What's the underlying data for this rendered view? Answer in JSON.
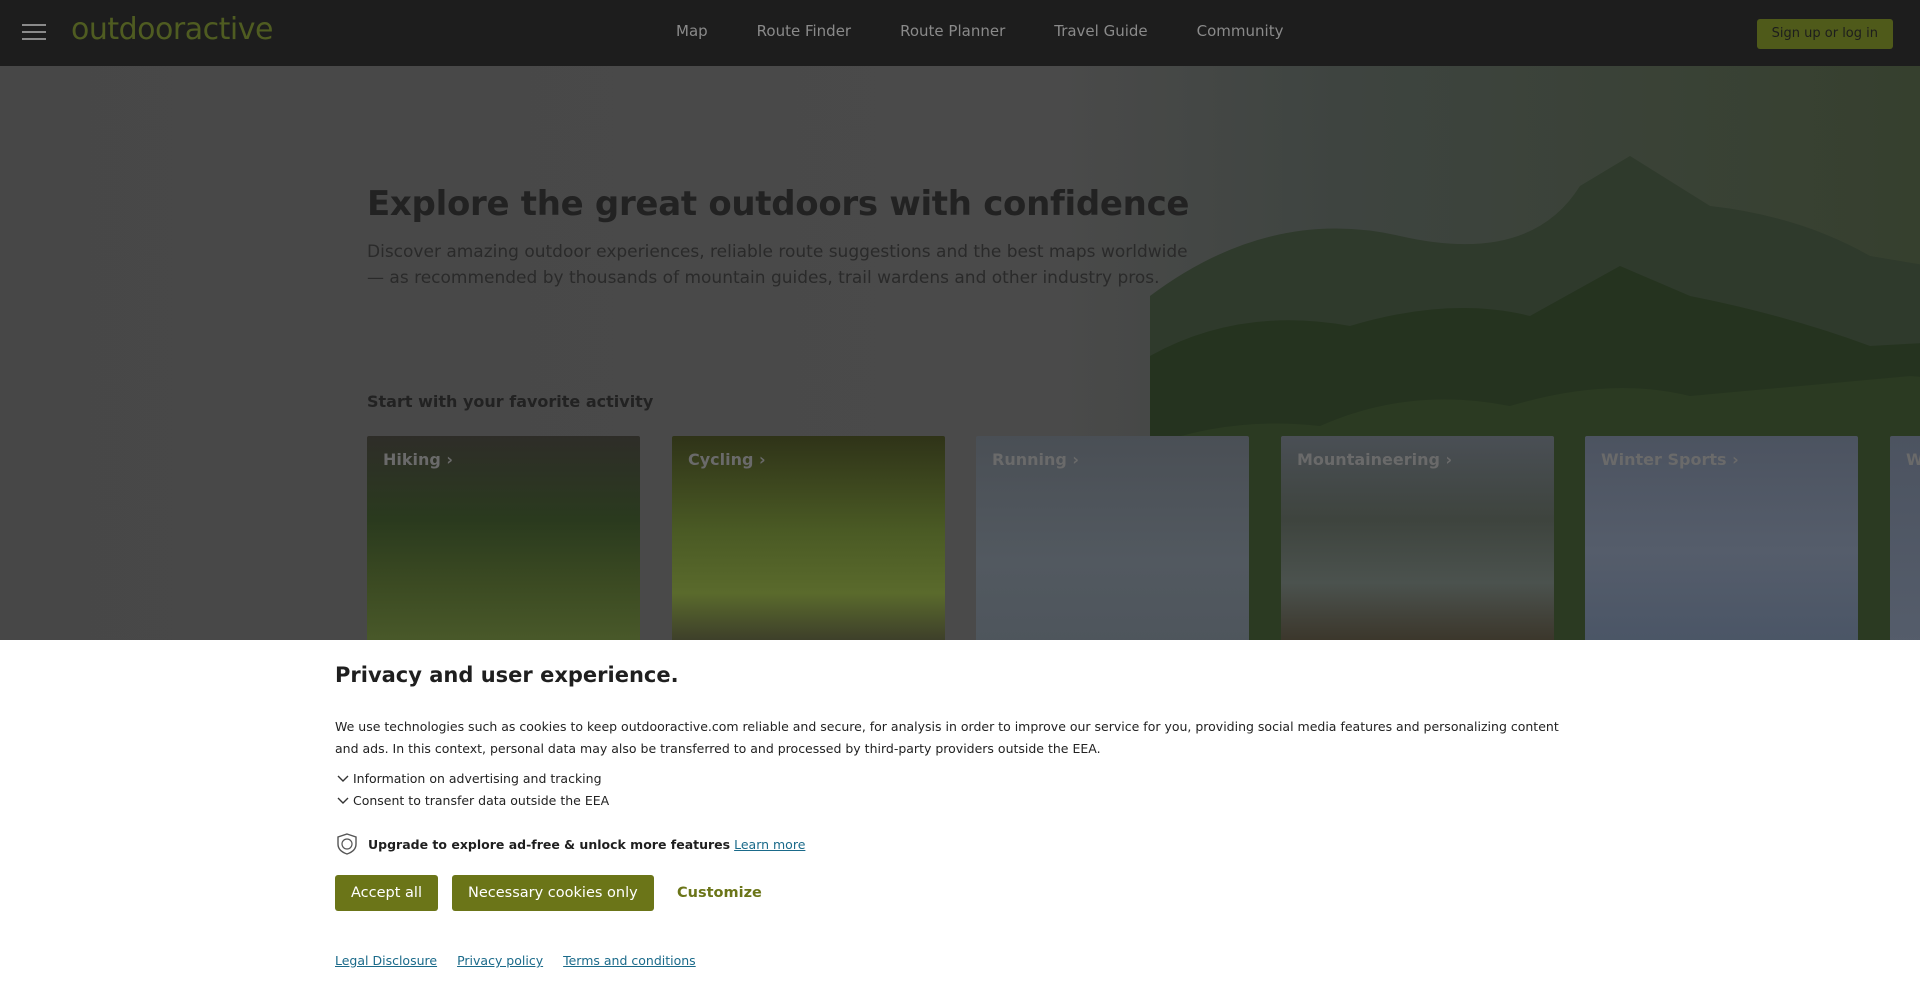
{
  "header": {
    "logo": "outdooractive",
    "nav": [
      "Map",
      "Route Finder",
      "Route Planner",
      "Travel Guide",
      "Community"
    ],
    "login_label": "Sign up or log in"
  },
  "hero": {
    "title": "Explore the great outdoors with confidence",
    "subtitle": "Discover amazing outdoor experiences, reliable route suggestions and the best maps worldwide — as recommended by thousands of mountain guides, trail wardens and other industry pros.",
    "activities_title": "Start with your favorite activity",
    "activities": [
      "Hiking",
      "Cycling",
      "Running",
      "Mountaineering",
      "Winter Sports",
      "W"
    ]
  },
  "consent": {
    "title": "Privacy and user experience.",
    "text": "We use technologies such as cookies to keep outdooractive.com reliable and secure, for analysis in order to improve our service for you, providing social media features and personalizing content and ads. In this context, personal data may also be transferred to and processed by third-party providers outside the EEA.",
    "toggle_advertising": "Information on advertising and tracking",
    "toggle_transfer": "Consent to transfer data outside the EEA",
    "upgrade_text": "Upgrade to explore ad-free & unlock more features",
    "learn_more": "Learn more",
    "accept_all": "Accept all",
    "necessary_only": "Necessary cookies only",
    "customize": "Customize",
    "footer_links": [
      "Legal Disclosure",
      "Privacy policy",
      "Terms and conditions"
    ]
  },
  "colors": {
    "brand_green": "#6b7518",
    "link_blue": "#1a6a8a"
  }
}
